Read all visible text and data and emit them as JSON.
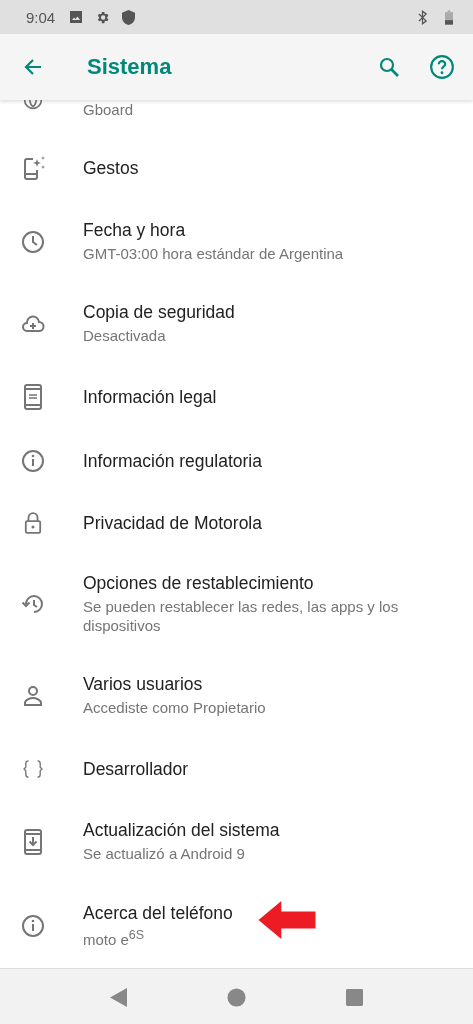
{
  "status_bar": {
    "time": "9:04"
  },
  "app_bar": {
    "title": "Sistema"
  },
  "partial_item": {
    "subtitle": "Gboard"
  },
  "items": [
    {
      "title": "Gestos",
      "pointed": false
    },
    {
      "title": "Fecha y hora",
      "subtitle": "GMT-03:00 hora estándar de Argentina",
      "pointed": false
    },
    {
      "title": "Copia de seguridad",
      "subtitle": "Desactivada",
      "pointed": false
    },
    {
      "title": "Información legal",
      "pointed": false
    },
    {
      "title": "Información regulatoria",
      "pointed": false
    },
    {
      "title": "Privacidad de Motorola",
      "pointed": false
    },
    {
      "title": "Opciones de restablecimiento",
      "subtitle": "Se pueden restablecer las redes, las apps y los dispositivos",
      "pointed": false
    },
    {
      "title": "Varios usuarios",
      "subtitle": "Accediste como Propietario",
      "pointed": false
    },
    {
      "title": "Desarrollador",
      "pointed": false
    },
    {
      "title": "Actualización del sistema",
      "subtitle": "Se actualizó a Android 9",
      "pointed": false
    },
    {
      "title": "Acerca del teléfono",
      "subtitle": "moto e$^{6S}$",
      "pointed": true
    }
  ]
}
